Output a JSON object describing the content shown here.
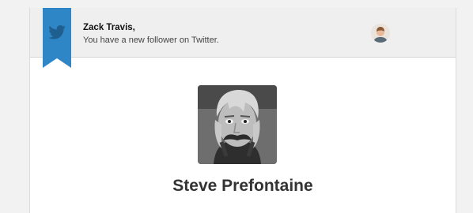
{
  "notification": {
    "greeting": "Zack Travis,",
    "message": "You have a new follower on Twitter.",
    "service_icon": "twitter-bird-icon",
    "ribbon_color": "#2f86c7"
  },
  "follower": {
    "name": "Steve Prefontaine"
  },
  "colors": {
    "page_background": "#f2f2f2",
    "header_background": "#efefef",
    "card_background": "#ffffff",
    "name_text": "#333333"
  }
}
